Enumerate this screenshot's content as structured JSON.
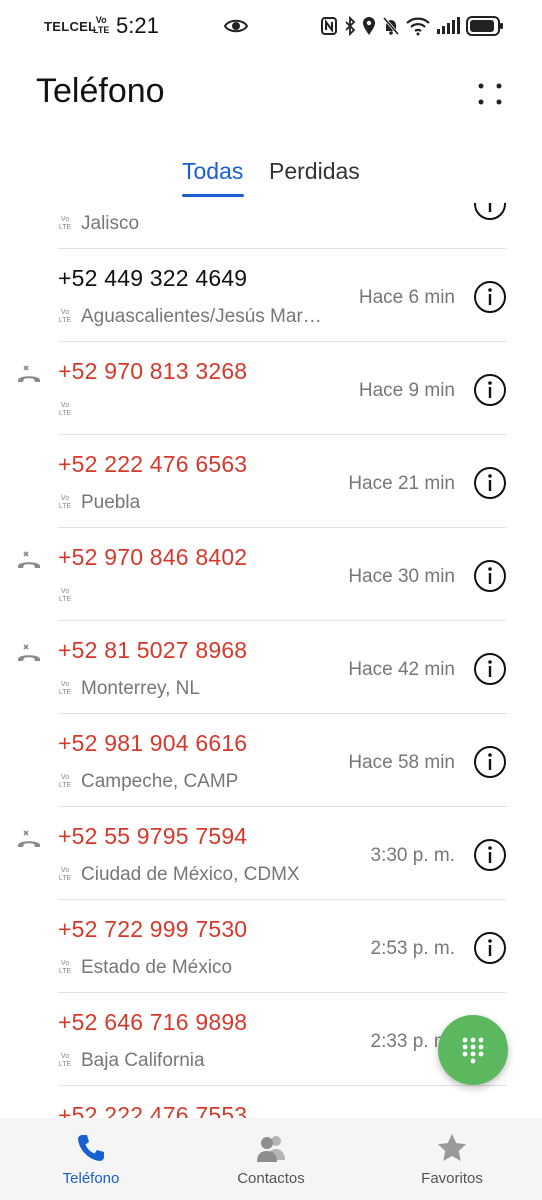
{
  "status_bar": {
    "carrier": "TELCEL",
    "volte_top": "Vo",
    "volte_bottom": "LTE",
    "time": "5:21"
  },
  "header": {
    "title": "Teléfono"
  },
  "tabs": [
    {
      "label": "Todas",
      "selected": true
    },
    {
      "label": "Perdidas",
      "selected": false
    }
  ],
  "calls": [
    {
      "number": "",
      "location": "Jalisco",
      "time": "",
      "missed": false,
      "answered": false
    },
    {
      "number": "+52 449 322 4649",
      "location": "Aguascalientes/Jesús Mar…",
      "time": "Hace 6 min",
      "missed": false,
      "answered": true
    },
    {
      "number": "+52 970 813 3268",
      "location": "",
      "time": "Hace 9 min",
      "missed": true,
      "answered": false
    },
    {
      "number": "+52 222 476 6563",
      "location": "Puebla",
      "time": "Hace 21 min",
      "missed": false,
      "answered": false
    },
    {
      "number": "+52 970 846 8402",
      "location": "",
      "time": "Hace 30 min",
      "missed": true,
      "answered": false
    },
    {
      "number": "+52 81 5027 8968",
      "location": "Monterrey, NL",
      "time": "Hace 42 min",
      "missed": true,
      "answered": false
    },
    {
      "number": "+52 981 904 6616",
      "location": "Campeche, CAMP",
      "time": "Hace 58 min",
      "missed": false,
      "answered": false
    },
    {
      "number": "+52 55 9795 7594",
      "location": "Ciudad de México, CDMX",
      "time": "3:30 p. m.",
      "missed": true,
      "answered": false
    },
    {
      "number": "+52 722 999 7530",
      "location": "Estado de México",
      "time": "2:53 p. m.",
      "missed": false,
      "answered": false
    },
    {
      "number": "+52 646 716 9898",
      "location": "Baja California",
      "time": "2:33 p. m.",
      "missed": false,
      "answered": false
    },
    {
      "number": "+52 222 476 7553",
      "location": "",
      "time": "",
      "missed": false,
      "answered": false
    }
  ],
  "volte_small_top": "Vo",
  "volte_small_bottom": "LTE",
  "bottom_nav": [
    {
      "label": "Teléfono",
      "icon": "phone-icon",
      "selected": true
    },
    {
      "label": "Contactos",
      "icon": "contacts-icon",
      "selected": false
    },
    {
      "label": "Favoritos",
      "icon": "star-icon",
      "selected": false
    }
  ],
  "colors": {
    "accent": "#1a5fd0",
    "missed": "#d6392b",
    "fab": "#5cb85f"
  }
}
